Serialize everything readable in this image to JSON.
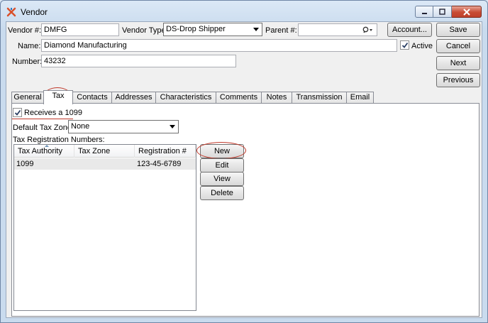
{
  "window": {
    "title": "Vendor",
    "controls": [
      "minimize",
      "maximize",
      "close"
    ]
  },
  "header": {
    "vendor_no_label": "Vendor #:",
    "vendor_no_value": "DMFG",
    "vendor_type_label": "Vendor Type:",
    "vendor_type_value": "DS-Drop Shipper",
    "parent_label": "Parent #:",
    "parent_value": "",
    "name_label": "Name:",
    "name_value": "Diamond Manufacturing",
    "active_label": "Active",
    "active_checked": true,
    "number_label": "Number:",
    "number_value": "43232"
  },
  "buttons": {
    "account": "Account...",
    "save": "Save",
    "cancel": "Cancel",
    "next": "Next",
    "previous": "Previous"
  },
  "tabs": [
    {
      "label": "General"
    },
    {
      "label": "Tax",
      "active": true
    },
    {
      "label": "Contacts"
    },
    {
      "label": "Addresses"
    },
    {
      "label": "Characteristics"
    },
    {
      "label": "Comments"
    },
    {
      "label": "Notes"
    },
    {
      "label": "Transmission"
    },
    {
      "label": "Email"
    }
  ],
  "tax": {
    "receives_1099_label": "Receives a 1099",
    "receives_1099_checked": true,
    "default_zone_label": "Default Tax Zone:",
    "default_zone_value": "None",
    "registrations_label": "Tax Registration Numbers:",
    "columns": [
      "Tax Authority",
      "Tax Zone",
      "Registration #"
    ],
    "rows": [
      {
        "authority": "1099",
        "zone": "",
        "registration": "123-45-6789"
      }
    ],
    "new_button": "New",
    "edit_button": "Edit",
    "view_button": "View",
    "delete_button": "Delete"
  },
  "colors": {
    "highlight": "#c0392b",
    "title_bar": "#dbe8f6",
    "close_button": "#c84c35"
  }
}
